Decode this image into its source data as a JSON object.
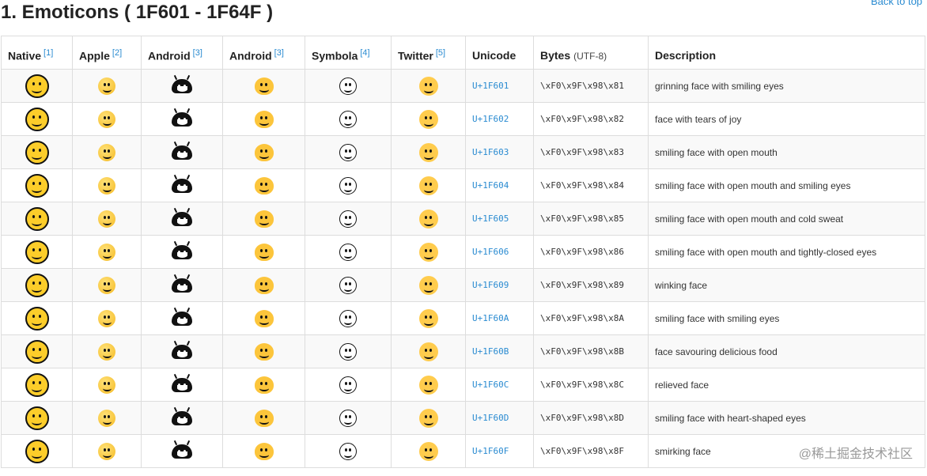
{
  "page": {
    "title": "1. Emoticons ( 1F601 - 1F64F )",
    "back_to_top": "Back to top",
    "watermark": "@稀土掘金技术社区"
  },
  "headers": {
    "native": "Native",
    "native_ref": "[1]",
    "apple": "Apple",
    "apple_ref": "[2]",
    "android1": "Android",
    "android1_ref": "[3]",
    "android2": "Android",
    "android2_ref": "[3]",
    "symbola": "Symbola",
    "symbola_ref": "[4]",
    "twitter": "Twitter",
    "twitter_ref": "[5]",
    "unicode": "Unicode",
    "bytes": "Bytes",
    "bytes_sub": "(UTF-8)",
    "description": "Description"
  },
  "rows": [
    {
      "unicode": "U+1F601",
      "bytes": "\\xF0\\x9F\\x98\\x81",
      "description": "grinning face with smiling eyes"
    },
    {
      "unicode": "U+1F602",
      "bytes": "\\xF0\\x9F\\x98\\x82",
      "description": "face with tears of joy"
    },
    {
      "unicode": "U+1F603",
      "bytes": "\\xF0\\x9F\\x98\\x83",
      "description": "smiling face with open mouth"
    },
    {
      "unicode": "U+1F604",
      "bytes": "\\xF0\\x9F\\x98\\x84",
      "description": "smiling face with open mouth and smiling eyes"
    },
    {
      "unicode": "U+1F605",
      "bytes": "\\xF0\\x9F\\x98\\x85",
      "description": "smiling face with open mouth and cold sweat"
    },
    {
      "unicode": "U+1F606",
      "bytes": "\\xF0\\x9F\\x98\\x86",
      "description": "smiling face with open mouth and tightly-closed eyes"
    },
    {
      "unicode": "U+1F609",
      "bytes": "\\xF0\\x9F\\x98\\x89",
      "description": "winking face"
    },
    {
      "unicode": "U+1F60A",
      "bytes": "\\xF0\\x9F\\x98\\x8A",
      "description": "smiling face with smiling eyes"
    },
    {
      "unicode": "U+1F60B",
      "bytes": "\\xF0\\x9F\\x98\\x8B",
      "description": "face savouring delicious food"
    },
    {
      "unicode": "U+1F60C",
      "bytes": "\\xF0\\x9F\\x98\\x8C",
      "description": "relieved face"
    },
    {
      "unicode": "U+1F60D",
      "bytes": "\\xF0\\x9F\\x98\\x8D",
      "description": "smiling face with heart-shaped eyes"
    },
    {
      "unicode": "U+1F60F",
      "bytes": "\\xF0\\x9F\\x98\\x8F",
      "description": "smirking face"
    }
  ]
}
